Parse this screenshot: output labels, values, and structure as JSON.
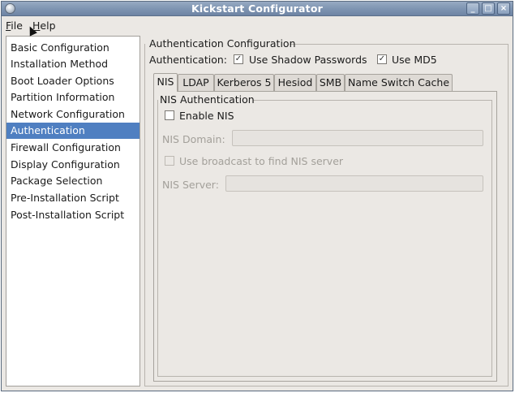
{
  "window": {
    "title": "Kickstart Configurator",
    "minimize_glyph": "_",
    "maximize_glyph": "□",
    "close_glyph": "×"
  },
  "menubar": {
    "file_accel": "F",
    "file_rest": "ile",
    "help_accel": "H",
    "help_rest": "elp"
  },
  "sidebar": {
    "items": [
      {
        "label": "Basic Configuration",
        "selected": false
      },
      {
        "label": "Installation Method",
        "selected": false
      },
      {
        "label": "Boot Loader Options",
        "selected": false
      },
      {
        "label": "Partition Information",
        "selected": false
      },
      {
        "label": "Network Configuration",
        "selected": false
      },
      {
        "label": "Authentication",
        "selected": true
      },
      {
        "label": "Firewall Configuration",
        "selected": false
      },
      {
        "label": "Display Configuration",
        "selected": false
      },
      {
        "label": "Package Selection",
        "selected": false
      },
      {
        "label": "Pre-Installation Script",
        "selected": false
      },
      {
        "label": "Post-Installation Script",
        "selected": false
      }
    ]
  },
  "main": {
    "section_title": "Authentication Configuration",
    "auth_label": "Authentication:",
    "shadow": {
      "label": "Use Shadow Passwords",
      "checked": true
    },
    "md5": {
      "label": "Use MD5",
      "checked": true
    },
    "tabs": [
      {
        "label": "NIS",
        "active": true
      },
      {
        "label": "LDAP",
        "active": false
      },
      {
        "label": "Kerberos 5",
        "active": false
      },
      {
        "label": "Hesiod",
        "active": false
      },
      {
        "label": "SMB",
        "active": false
      },
      {
        "label": "Name Switch Cache",
        "active": false
      }
    ],
    "nis": {
      "group_title": "NIS Authentication",
      "enable_label": "Enable NIS",
      "enable_checked": false,
      "domain_label": "NIS Domain:",
      "domain_value": "",
      "broadcast_label": "Use broadcast to find NIS server",
      "broadcast_checked": false,
      "server_label": "NIS Server:",
      "server_value": ""
    }
  },
  "icons": {
    "check_glyph": "✓"
  }
}
